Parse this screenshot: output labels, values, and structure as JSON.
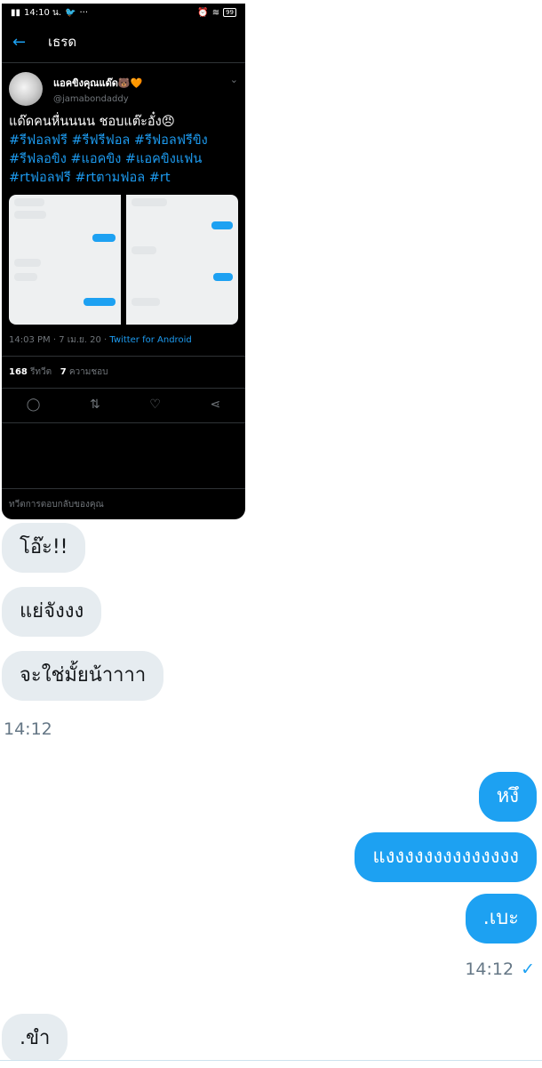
{
  "screenshot": {
    "status_bar": {
      "time": "14:10 น.",
      "battery": "99"
    },
    "header": {
      "title": "เธรด"
    },
    "tweet": {
      "display_name": "แอคขิงคุณแด๊ด🐻🧡",
      "handle": "@jamabondaddy",
      "text": "แด๊ดคนหื่นนนน ชอบแต๊ะอั๋ง😠",
      "hashtags_line1": "#รีฟอลฟรี #รีฟรีฟอล #รีฟอลฟรีขิง",
      "hashtags_line2": "#รีฟลอขิง #แอคขิง #แอคขิงแฟน",
      "hashtags_line3": "#rtฟอลฟรี #rtตามฟอล #rt",
      "timestamp": "14:03 PM · 7 เม.ย. 20 · ",
      "source": "Twitter for Android",
      "retweets_count": "168",
      "retweets_label": "รีทวีต",
      "likes_count": "7",
      "likes_label": "ความชอบ"
    },
    "reply_placeholder": "ทวีตการตอบกลับของคุณ"
  },
  "messages_in_1": [
    "โอ๊ะ!!",
    "แย่จังงง",
    "จะใช่มั้ยน้าาาา"
  ],
  "time_in_1": "14:12",
  "messages_out_1": [
    "หงึ",
    "แงงงงงงงงงงงงงง",
    ".เบะ"
  ],
  "time_out_1": "14:12",
  "messages_in_2": [
    ".ขำ"
  ],
  "colors": {
    "accent": "#1da1f2",
    "incoming_bubble": "#e6ecf0",
    "tweet_bg": "#000000"
  },
  "icons": [
    "back-arrow-icon",
    "reply-icon",
    "retweet-icon",
    "like-icon",
    "share-icon",
    "read-check-icon"
  ]
}
